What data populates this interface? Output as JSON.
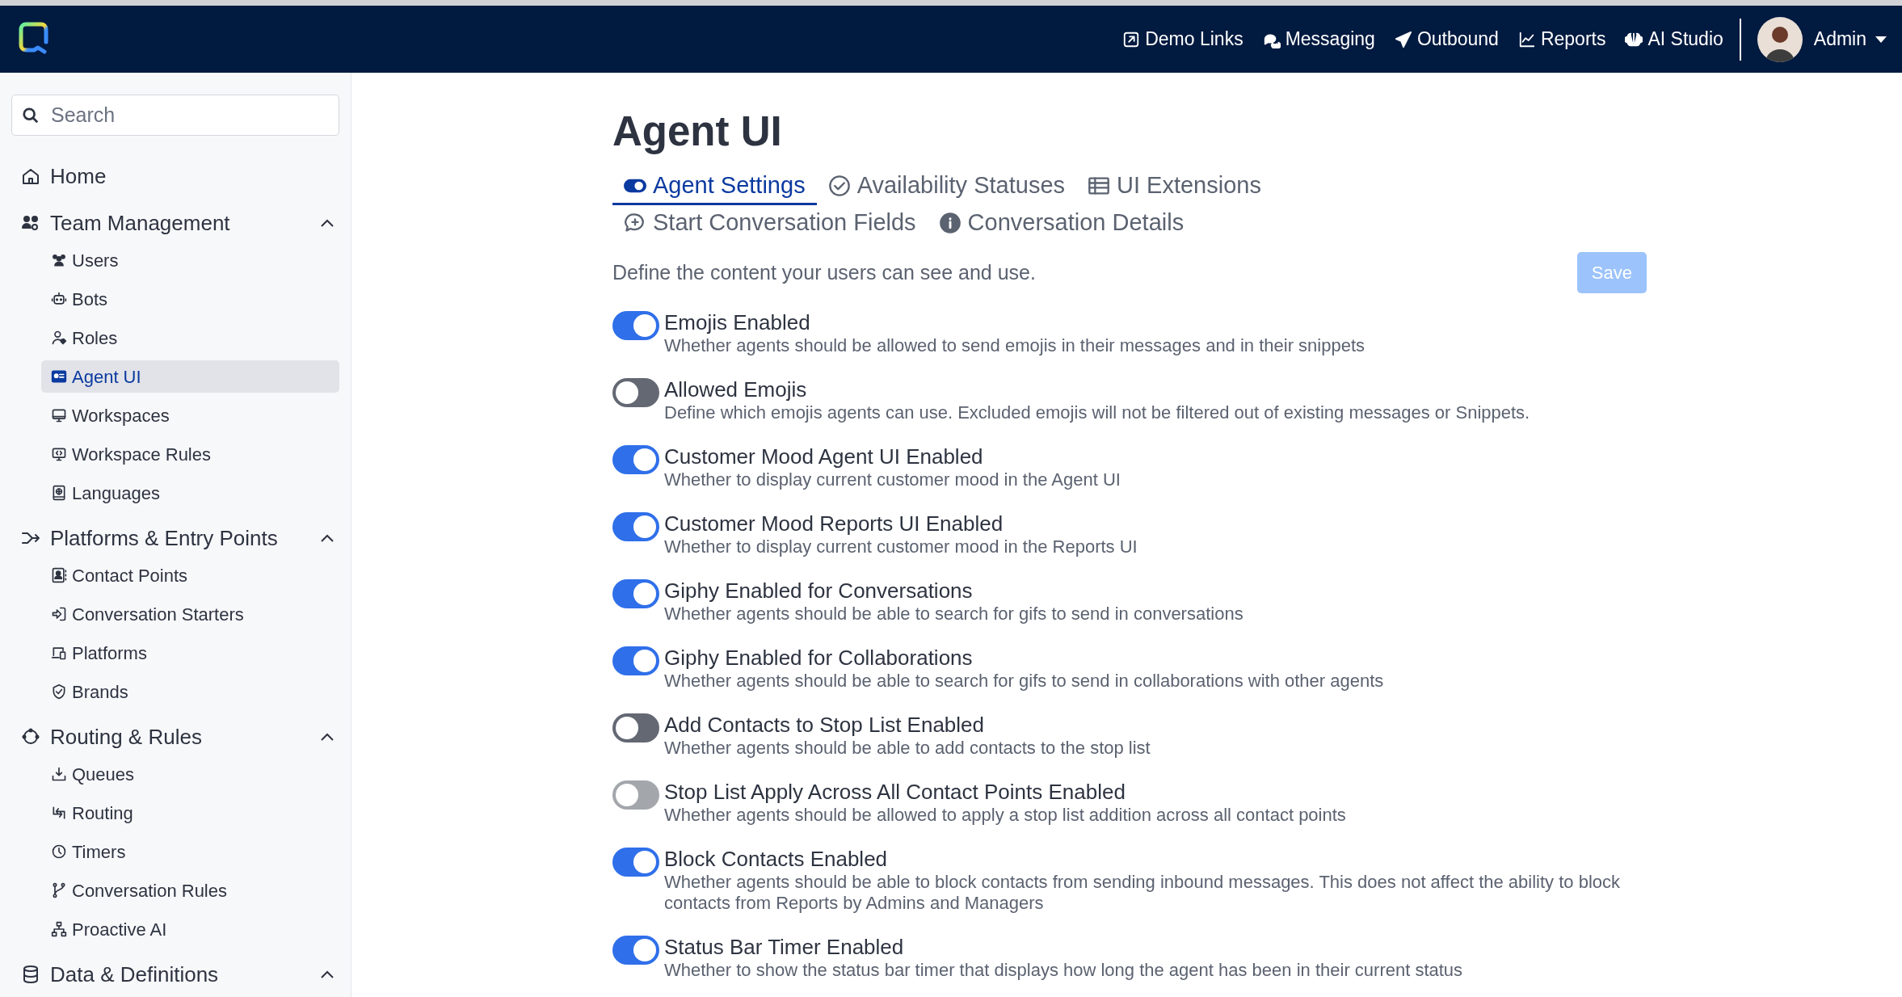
{
  "topbar": {
    "links": [
      {
        "label": "Demo Links"
      },
      {
        "label": "Messaging"
      },
      {
        "label": "Outbound"
      },
      {
        "label": "Reports"
      },
      {
        "label": "AI Studio"
      }
    ],
    "user": "Admin"
  },
  "sidebar": {
    "search": {
      "placeholder": "Search"
    },
    "sections": [
      {
        "label": "Home"
      },
      {
        "label": "Team Management",
        "expanded": true,
        "children": [
          {
            "label": "Users",
            "selected": false
          },
          {
            "label": "Bots",
            "selected": false
          },
          {
            "label": "Roles",
            "selected": false
          },
          {
            "label": "Agent UI",
            "selected": true
          },
          {
            "label": "Workspaces",
            "selected": false
          },
          {
            "label": "Workspace Rules",
            "selected": false
          },
          {
            "label": "Languages",
            "selected": false
          }
        ]
      },
      {
        "label": "Platforms & Entry Points",
        "expanded": true,
        "children": [
          {
            "label": "Contact Points",
            "selected": false
          },
          {
            "label": "Conversation Starters",
            "selected": false
          },
          {
            "label": "Platforms",
            "selected": false
          },
          {
            "label": "Brands",
            "selected": false
          }
        ]
      },
      {
        "label": "Routing & Rules",
        "expanded": true,
        "children": [
          {
            "label": "Queues",
            "selected": false
          },
          {
            "label": "Routing",
            "selected": false
          },
          {
            "label": "Timers",
            "selected": false
          },
          {
            "label": "Conversation Rules",
            "selected": false
          },
          {
            "label": "Proactive AI",
            "selected": false
          }
        ]
      },
      {
        "label": "Data & Definitions",
        "expanded": true
      }
    ]
  },
  "page": {
    "title": "Agent UI",
    "tabs": [
      {
        "label": "Agent Settings",
        "selected": true
      },
      {
        "label": "Availability Statuses",
        "selected": false
      },
      {
        "label": "UI Extensions",
        "selected": false
      },
      {
        "label": "Start Conversation Fields",
        "selected": false
      },
      {
        "label": "Conversation Details",
        "selected": false
      }
    ],
    "description": "Define the content your users can see and use.",
    "save_button": {
      "label": "Save",
      "disabled": true
    },
    "settings": [
      {
        "title": "Emojis Enabled",
        "description": "Whether agents should be allowed to send emojis in their messages and in their snippets",
        "on": true,
        "disabled": false
      },
      {
        "title": "Allowed Emojis",
        "description": "Define which emojis agents can use. Excluded emojis will not be filtered out of existing messages or Snippets.",
        "on": false,
        "disabled": false
      },
      {
        "title": "Customer Mood Agent UI Enabled",
        "description": "Whether to display current customer mood in the Agent UI",
        "on": true,
        "disabled": false
      },
      {
        "title": "Customer Mood Reports UI Enabled",
        "description": "Whether to display current customer mood in the Reports UI",
        "on": true,
        "disabled": false
      },
      {
        "title": "Giphy Enabled for Conversations",
        "description": "Whether agents should be able to search for gifs to send in conversations",
        "on": true,
        "disabled": false
      },
      {
        "title": "Giphy Enabled for Collaborations",
        "description": "Whether agents should be able to search for gifs to send in collaborations with other agents",
        "on": true,
        "disabled": false
      },
      {
        "title": "Add Contacts to Stop List Enabled",
        "description": "Whether agents should be able to add contacts to the stop list",
        "on": false,
        "disabled": false
      },
      {
        "title": "Stop List Apply Across All Contact Points Enabled",
        "description": "Whether agents should be allowed to apply a stop list addition across all contact points",
        "on": false,
        "disabled": true
      },
      {
        "title": "Block Contacts Enabled",
        "description": "Whether agents should be able to block contacts from sending inbound messages. This does not affect the ability to block contacts from Reports by Admins and Managers",
        "on": true,
        "disabled": false
      },
      {
        "title": "Status Bar Timer Enabled",
        "description": "Whether to show the status bar timer that displays how long the agent has been in their current status",
        "on": true,
        "disabled": false
      }
    ]
  }
}
